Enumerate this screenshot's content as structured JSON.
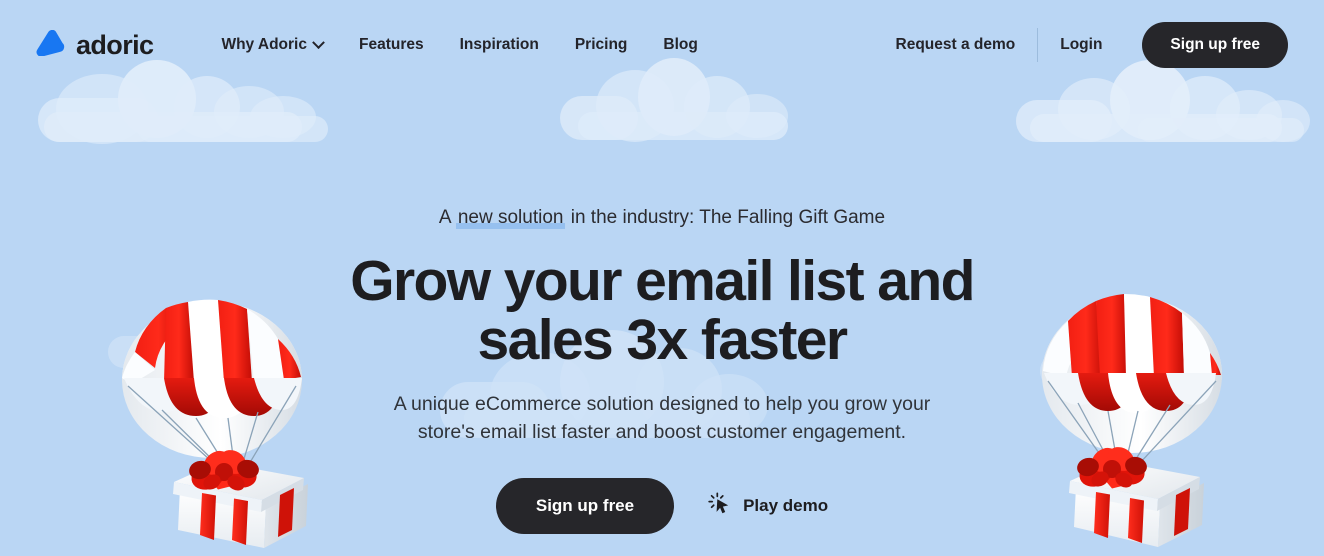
{
  "brand": {
    "name": "adoric",
    "logo_icon": "adoric-triangle-logo",
    "logo_color": "#1877f2"
  },
  "theme": {
    "background": "#bad6f4",
    "cloud": "#ffffff",
    "text_dark": "#1d1d20",
    "button_dark": "#26262a",
    "highlight": "#8fbced",
    "gift_red": "#e8251b",
    "gift_white": "#ffffff"
  },
  "nav": {
    "items": [
      {
        "label": "Why Adoric",
        "has_dropdown": true,
        "icon": "chevron-down-icon"
      },
      {
        "label": "Features",
        "has_dropdown": false
      },
      {
        "label": "Inspiration",
        "has_dropdown": false
      },
      {
        "label": "Pricing",
        "has_dropdown": false
      },
      {
        "label": "Blog",
        "has_dropdown": false
      }
    ],
    "request_demo": "Request a demo",
    "login": "Login",
    "signup": "Sign up free"
  },
  "hero": {
    "eyebrow_prefix": "A ",
    "eyebrow_highlight": "new solution",
    "eyebrow_suffix": " in the industry: The Falling Gift Game",
    "headline_line1": "Grow your email list and",
    "headline_line2": "sales 3x faster",
    "subcopy_line1": "A unique eCommerce solution designed to help you grow your",
    "subcopy_line2": "store's email list faster and boost customer engagement.",
    "cta_primary": "Sign up free",
    "cta_secondary": "Play demo",
    "cta_secondary_icon": "cursor-click-icon"
  },
  "illustrations": {
    "left": {
      "name": "parachute-gift-left",
      "alt": "Red and white parachute carrying a white gift box with red ribbon"
    },
    "right": {
      "name": "parachute-gift-right",
      "alt": "Red and white parachute carrying a white gift box with red ribbon"
    }
  }
}
